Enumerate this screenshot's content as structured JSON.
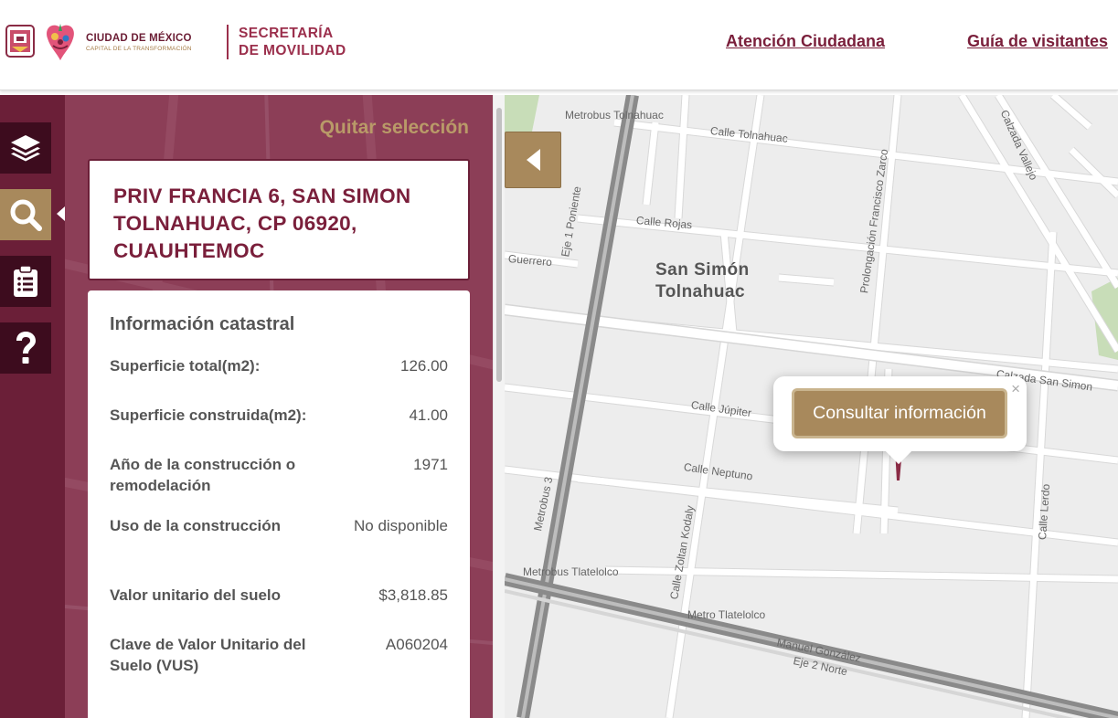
{
  "header": {
    "brand_title": "CIUDAD DE MÉXICO",
    "brand_subtitle": "CAPITAL DE LA TRANSFORMACIÓN",
    "secretaria_line1": "SECRETARÍA",
    "secretaria_line2": "DE MOVILIDAD",
    "nav": [
      {
        "label": "Atención Ciudadana"
      },
      {
        "label": "Guía de visitantes"
      }
    ]
  },
  "rail": {
    "items": [
      {
        "icon": "layers-icon",
        "active": false
      },
      {
        "icon": "search-icon",
        "active": true
      },
      {
        "icon": "clipboard-icon",
        "active": false
      },
      {
        "icon": "help-icon",
        "active": false
      }
    ]
  },
  "panel": {
    "clear_selection": "Quitar selección",
    "address": "PRIV FRANCIA 6, SAN SIMON TOLNAHUAC, CP 06920, CUAUHTEMOC",
    "info_title": "Información catastral",
    "rows": [
      {
        "label": "Superficie total(m2):",
        "value": "126.00"
      },
      {
        "label": "Superficie construida(m2):",
        "value": "41.00"
      },
      {
        "label": "Año de la construcción o remodelación",
        "value": "1971"
      },
      {
        "label": "Uso de la construcción",
        "value": "No disponible"
      },
      {
        "label": "Valor unitario del suelo",
        "value": "$3,818.85"
      },
      {
        "label": "Clave de Valor Unitario del Suelo (VUS)",
        "value": "A060204"
      }
    ]
  },
  "map": {
    "popup_button": "Consultar información",
    "popup_close": "×",
    "neighborhood": "San Simón Tolnahuac",
    "streets": [
      "Calle Tolnahuac",
      "Calle Rojas",
      "Guerrero",
      "Eje 1 Poniente",
      "Prolongación Francisco Zarco",
      "Calzada Vallejo",
      "Calzada San Simon",
      "Calle Júpiter",
      "Calle Neptuno",
      "Calle Zoltan Kodaly",
      "Calle Lerdo",
      "Metrobus 3",
      "Manuel González",
      "Eje 2 Norte",
      "Metrobus Tolnahuac",
      "Metrobus Tlatelolco",
      "Metro Tlatelolco"
    ],
    "colors": {
      "road": "#ffffff",
      "road_edge": "#d6d6d6",
      "highway": "#8a8a8a",
      "park": "#c8ddb8",
      "land": "#ededed"
    }
  },
  "colors": {
    "primary": "#6b1f38",
    "accent_gold": "#a8895c",
    "dark_button": "#3d0c1e"
  }
}
